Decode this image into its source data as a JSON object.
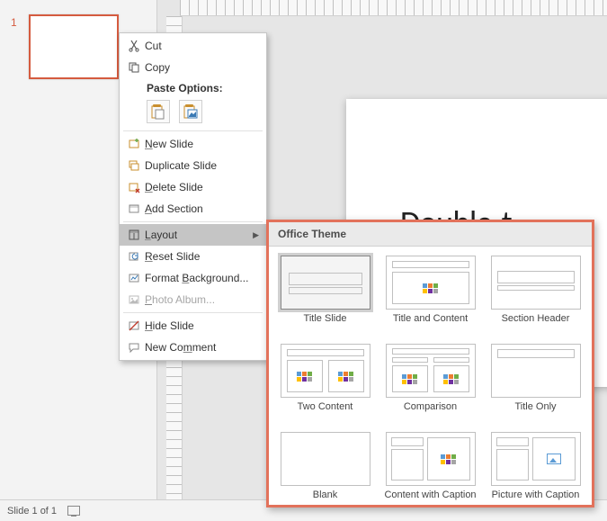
{
  "slide_panel": {
    "number": "1"
  },
  "canvas": {
    "placeholder_text": "Double-t"
  },
  "status": {
    "text": "Slide 1 of 1"
  },
  "context_menu": {
    "cut": "Cut",
    "copy": "Copy",
    "paste_options": "Paste Options:",
    "new_slide": "New Slide",
    "duplicate_slide": "Duplicate Slide",
    "delete_slide": "Delete Slide",
    "add_section": "Add Section",
    "layout": "Layout",
    "reset_slide": "Reset Slide",
    "format_background": "Format Background...",
    "photo_album": "Photo Album...",
    "hide_slide": "Hide Slide",
    "new_comment": "New Comment"
  },
  "layout_flyout": {
    "header": "Office Theme",
    "items": [
      "Title Slide",
      "Title and Content",
      "Section Header",
      "Two Content",
      "Comparison",
      "Title Only",
      "Blank",
      "Content with Caption",
      "Picture with Caption"
    ]
  }
}
